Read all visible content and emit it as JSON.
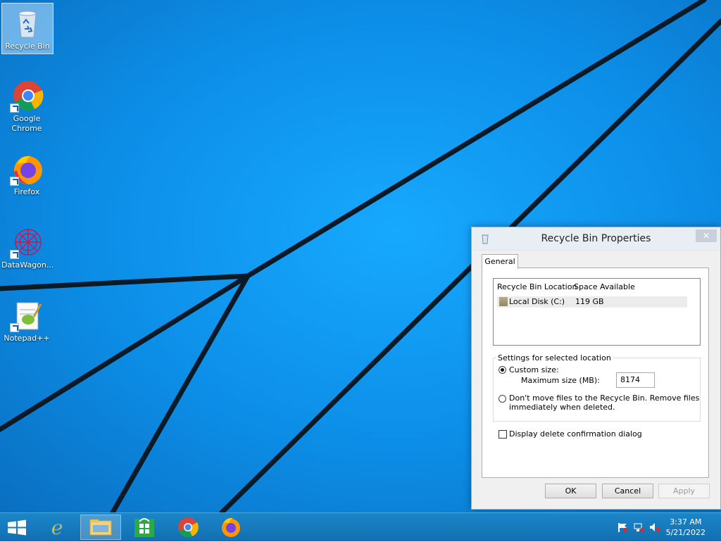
{
  "desktop": {
    "icons": [
      {
        "label": "Recycle Bin",
        "icon": "recycle-bin-icon"
      },
      {
        "label": "Google Chrome",
        "icon": "chrome-icon"
      },
      {
        "label": "Firefox",
        "icon": "firefox-icon"
      },
      {
        "label": "DataWagon...",
        "icon": "datawagon-icon"
      },
      {
        "label": "Notepad++",
        "icon": "notepadpp-icon"
      }
    ]
  },
  "dialog": {
    "title": "Recycle Bin Properties",
    "close_label": "✕",
    "tab_label": "General",
    "list": {
      "col_location": "Recycle Bin Location",
      "col_space": "Space Available",
      "rows": [
        {
          "location": "Local Disk (C:)",
          "space": "119 GB"
        }
      ]
    },
    "settings_legend": "Settings for selected location",
    "custom_size_label": "Custom size:",
    "max_size_label": "Maximum size (MB):",
    "max_size_value": "8174",
    "dont_move_label_1": "Don't move files to the Recycle Bin. Remove files",
    "dont_move_label_2": "immediately when deleted.",
    "confirm_label": "Display delete confirmation dialog",
    "custom_size_checked": true,
    "dont_move_checked": false,
    "confirm_checked": false,
    "ok_label": "OK",
    "cancel_label": "Cancel",
    "apply_label": "Apply"
  },
  "taskbar": {
    "items": [
      "start-icon",
      "internet-explorer-icon",
      "file-explorer-icon",
      "store-icon",
      "chrome-icon",
      "firefox-icon"
    ],
    "time": "3:37 AM",
    "date": "5/21/2022"
  }
}
